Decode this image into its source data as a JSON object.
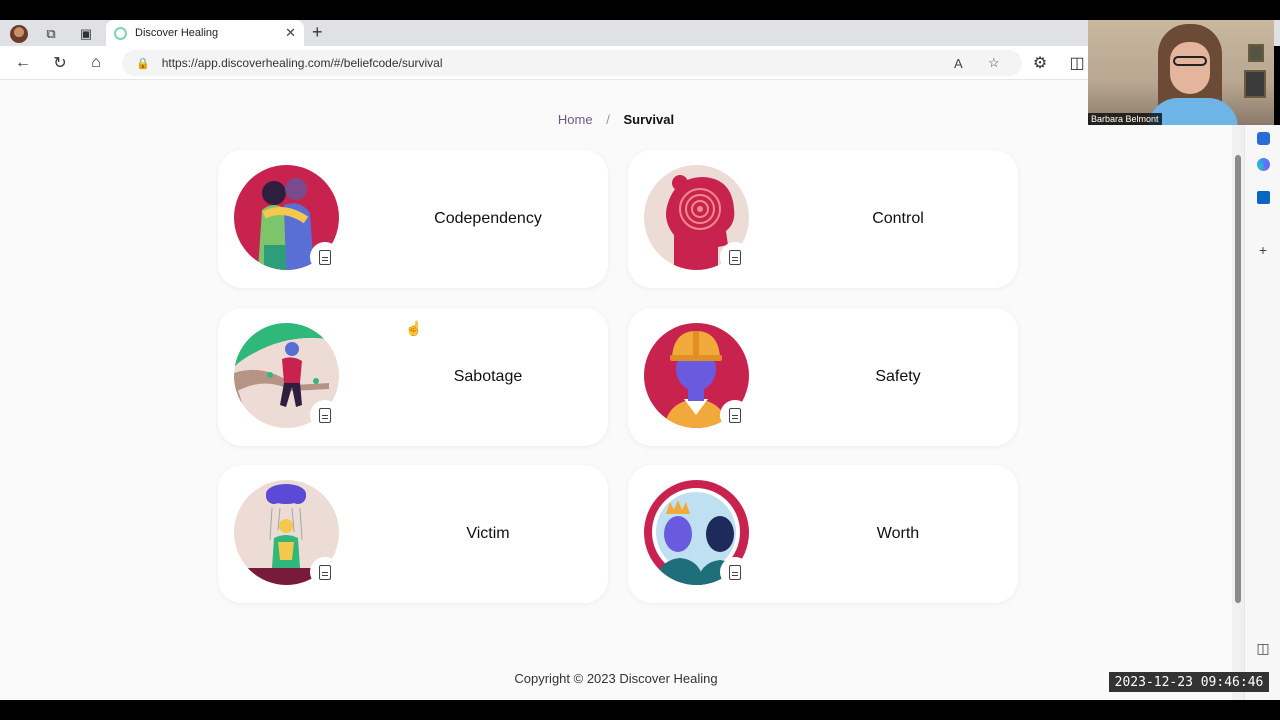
{
  "browser": {
    "tab_title": "Discover Healing",
    "url": "https://app.discoverhealing.com/#/beliefcode/survival",
    "close_glyph": "✕",
    "new_tab_glyph": "+",
    "icons": {
      "workspaces": "⧉",
      "tab_actions": "▣",
      "back": "←",
      "refresh": "↻",
      "home": "⌂",
      "lock": "🔒",
      "read_aloud": "A",
      "favorite": "☆",
      "extensions": "⚙",
      "split": "◫"
    }
  },
  "video_overlay": {
    "name": "Barbara Belmont"
  },
  "sidebar": {
    "add_glyph": "+",
    "panel_glyph": "◫"
  },
  "breadcrumb": {
    "home": "Home",
    "separator": "/",
    "current": "Survival"
  },
  "cards": [
    {
      "label": "Codependency",
      "icon": "codependency-illustration"
    },
    {
      "label": "Control",
      "icon": "control-illustration"
    },
    {
      "label": "Sabotage",
      "icon": "sabotage-illustration"
    },
    {
      "label": "Safety",
      "icon": "safety-illustration"
    },
    {
      "label": "Victim",
      "icon": "victim-illustration"
    },
    {
      "label": "Worth",
      "icon": "worth-illustration"
    }
  ],
  "footer": {
    "copyright": "Copyright © 2023 Discover Healing"
  },
  "timestamp": "2023-12-23 09:46:46",
  "colors": {
    "accent_crimson": "#c8234f",
    "accent_purple": "#6c5a8e",
    "card_bg": "#ffffff",
    "page_bg": "#fafafa"
  }
}
